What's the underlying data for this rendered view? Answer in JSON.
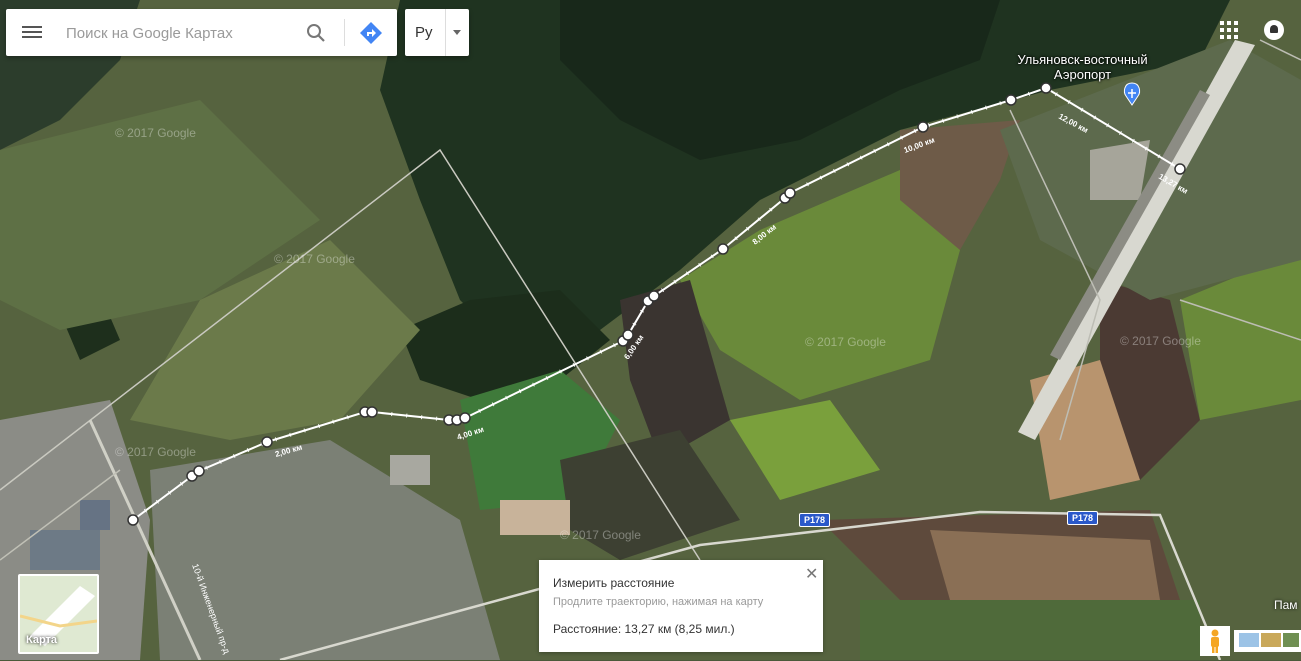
{
  "search": {
    "placeholder": "Поиск на Google Картах"
  },
  "language": {
    "label": "Ру"
  },
  "airport": {
    "line1": "Ульяновск-восточный",
    "line2": "Аэропорт"
  },
  "roads": {
    "badge1": "P178",
    "badge2": "P178",
    "street": "10-й Инженерный пр-д"
  },
  "distance_labels": [
    "2,00 км",
    "4,00 км",
    "6,00 км",
    "8,00 км",
    "10,00 км",
    "12,00 км",
    "13,27 км"
  ],
  "watermark": "© 2017 Google",
  "measure": {
    "title": "Измерить расстояние",
    "hint": "Продлите траекторию, нажимая на карту",
    "distance": "Расстояние: 13,27 км (8,25 мил.)"
  },
  "map_type": {
    "label": "Карта"
  },
  "place_partial": "Пам",
  "colors": {
    "accent": "#4285f4",
    "road_badge": "#2a58c9"
  }
}
